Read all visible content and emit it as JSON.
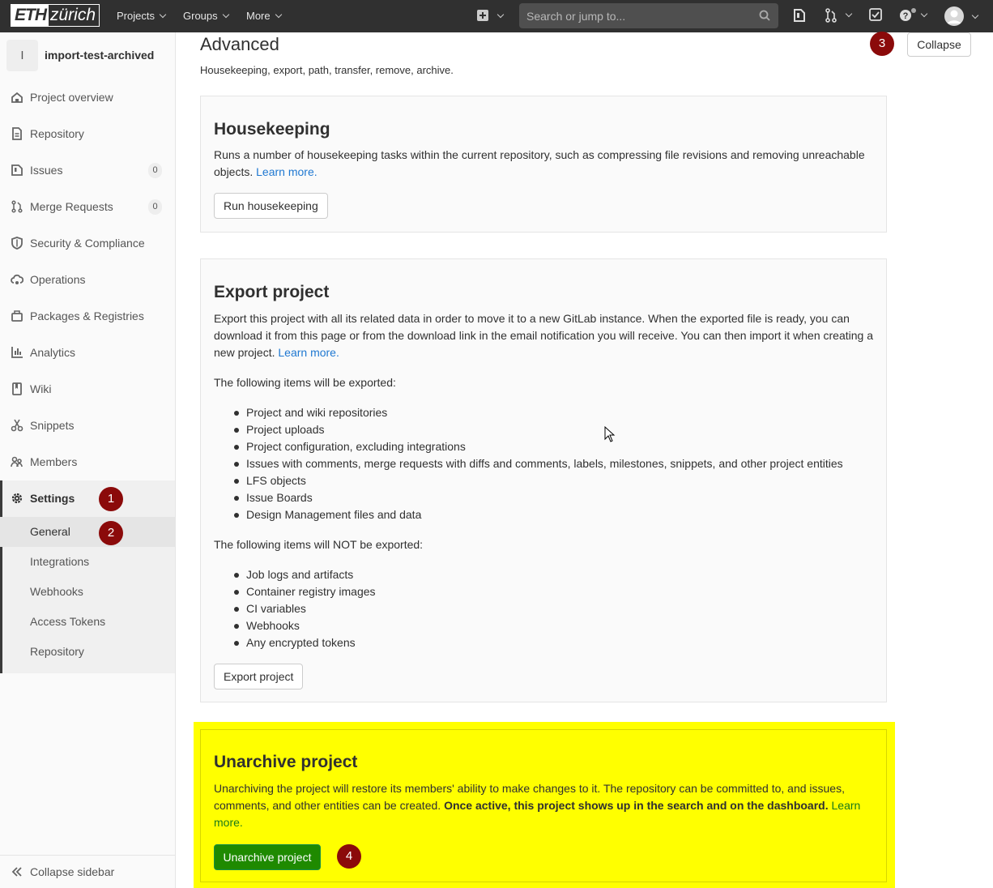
{
  "topbar": {
    "logo_left": "ETH",
    "logo_right": "zürich",
    "projects": "Projects",
    "groups": "Groups",
    "more": "More",
    "search_placeholder": "Search or jump to..."
  },
  "sidebar": {
    "project_initial": "I",
    "project_name": "import-test-archived",
    "items": [
      {
        "label": "Project overview",
        "icon": "home-icon"
      },
      {
        "label": "Repository",
        "icon": "doc-text-icon"
      },
      {
        "label": "Issues",
        "icon": "issues-icon",
        "count": "0"
      },
      {
        "label": "Merge Requests",
        "icon": "git-merge-icon",
        "count": "0"
      },
      {
        "label": "Security & Compliance",
        "icon": "shield-icon"
      },
      {
        "label": "Operations",
        "icon": "cloud-gear-icon"
      },
      {
        "label": "Packages & Registries",
        "icon": "package-icon"
      },
      {
        "label": "Analytics",
        "icon": "chart-icon"
      },
      {
        "label": "Wiki",
        "icon": "book-icon"
      },
      {
        "label": "Snippets",
        "icon": "snippet-icon"
      },
      {
        "label": "Members",
        "icon": "users-icon"
      }
    ],
    "settings": {
      "label": "Settings",
      "sub": [
        "General",
        "Integrations",
        "Webhooks",
        "Access Tokens",
        "Repository"
      ]
    },
    "collapse": "Collapse sidebar"
  },
  "badges": [
    "1",
    "2",
    "3",
    "4"
  ],
  "advanced": {
    "title": "Advanced",
    "subtitle": "Housekeeping, export, path, transfer, remove, archive.",
    "collapse_btn": "Collapse"
  },
  "housekeeping": {
    "title": "Housekeeping",
    "desc": "Runs a number of housekeeping tasks within the current repository, such as compressing file revisions and removing unreachable objects.",
    "learn": "Learn more.",
    "btn": "Run housekeeping"
  },
  "export": {
    "title": "Export project",
    "desc": "Export this project with all its related data in order to move it to a new GitLab instance. When the exported file is ready, you can download it from this page or from the download link in the email notification you will receive. You can then import it when creating a new project.",
    "learn": "Learn more.",
    "included_heading": "The following items will be exported:",
    "included": [
      "Project and wiki repositories",
      "Project uploads",
      "Project configuration, excluding integrations",
      "Issues with comments, merge requests with diffs and comments, labels, milestones, snippets, and other project entities",
      "LFS objects",
      "Issue Boards",
      "Design Management files and data"
    ],
    "excluded_heading": "The following items will NOT be exported:",
    "excluded": [
      "Job logs and artifacts",
      "Container registry images",
      "CI variables",
      "Webhooks",
      "Any encrypted tokens"
    ],
    "btn": "Export project"
  },
  "unarchive": {
    "title": "Unarchive project",
    "desc": "Unarchiving the project will restore its members' ability to make changes to it. The repository can be committed to, and issues, comments, and other entities can be created.",
    "desc_bold": "Once active, this project shows up in the search and on the dashboard.",
    "learn": "Learn more.",
    "btn": "Unarchive project"
  }
}
